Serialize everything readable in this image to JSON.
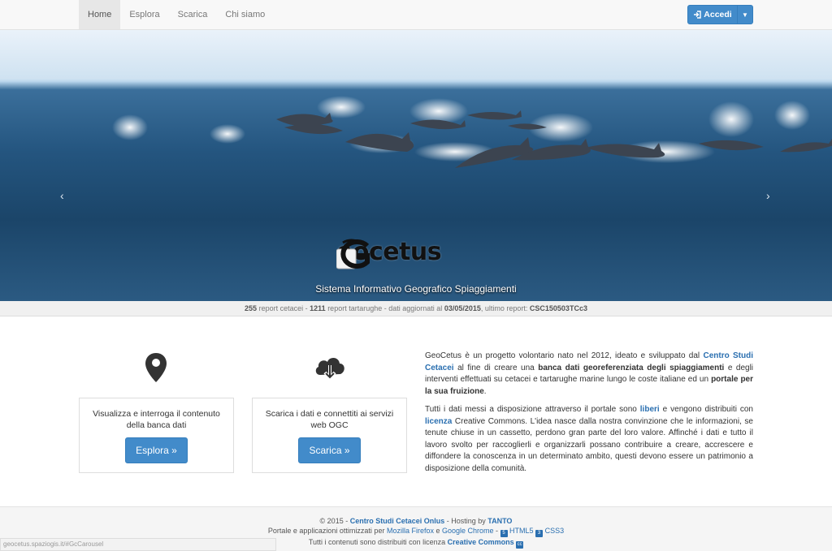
{
  "nav": {
    "items": [
      {
        "label": "Home",
        "active": true
      },
      {
        "label": "Esplora"
      },
      {
        "label": "Scarica"
      },
      {
        "label": "Chi siamo"
      }
    ],
    "login_label": "Accedi"
  },
  "hero": {
    "logo_text": "eocetus",
    "tagline": "Sistema Informativo Geografico Spiaggiamenti",
    "prev_arrow": "‹",
    "next_arrow": "›",
    "active_slide": 3,
    "slide_count": 3
  },
  "stats": {
    "cetacei_count": "255",
    "cetacei_label": "report cetacei",
    "sep1": "-",
    "tartarughe_count": "1211",
    "tartarughe_label": "report tartarughe",
    "updated_label": "- dati aggiornati al",
    "updated_date": "03/05/2015",
    "last_report_label": ", ultimo report:",
    "last_report": "CSC150503TCc3"
  },
  "features": {
    "explore": {
      "text": "Visualizza e interroga il contenuto della banca dati",
      "button": "Esplora »"
    },
    "download": {
      "text": "Scarica i dati e connettiti ai servizi web OGC",
      "button": "Scarica »"
    }
  },
  "description": {
    "p1_a": "GeoCetus è un progetto volontario nato nel 2012, ideato e sviluppato dal ",
    "p1_link": "Centro Studi Cetacei",
    "p1_b": " al fine di creare una ",
    "p1_bold1": "banca dati georeferenziata degli spiaggiamenti",
    "p1_c": " e degli interventi effettuati su cetacei e tartarughe marine lungo le coste italiane ed un ",
    "p1_bold2": "portale per la sua fruizione",
    "p1_d": ".",
    "p2_a": "Tutti i dati messi a disposizione attraverso il portale sono ",
    "p2_link1": "liberi",
    "p2_b": " e vengono distribuiti con ",
    "p2_link2": "licenza",
    "p2_c": " Creative Commons. L'idea nasce dalla nostra convinzione che le informazioni, se tenute chiuse in un cassetto, perdono gran parte del loro valore. Affinché i dati e tutto il lavoro svolto per raccoglierli e organizzarli possano contribuire a creare, accrescere e diffondere la conoscenza in un determinato ambito, questi devono essere un patrimonio a disposizione della comunità."
  },
  "footer": {
    "l1_a": "© 2015 - ",
    "l1_link": "Centro Studi Cetacei Onlus",
    "l1_b": " - Hosting by ",
    "l1_link2": "TANTO",
    "l2_a": "Portale e applicazioni ottimizzati per ",
    "l2_ff": "Mozilla Firefox",
    "l2_e": " e ",
    "l2_gc": "Google Chrome",
    "l2_sep": " - ",
    "l2_html5": "HTML5",
    "l2_css3": "CSS3",
    "l3_a": "Tutti i contenuti sono distribuiti con licenza ",
    "l3_link": "Creative Commons"
  },
  "statusbar": {
    "url": "geocetus.spaziogis.it/#GcCarousel"
  },
  "colors": {
    "primary": "#428bca",
    "link": "#2a6fb0"
  }
}
